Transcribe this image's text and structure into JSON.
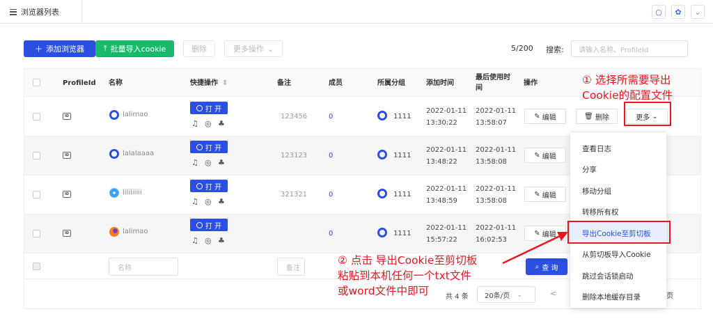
{
  "tab": {
    "title": "浏览器列表"
  },
  "top_icons": [
    "refresh-icon",
    "gear-icon",
    "chevron-down-icon"
  ],
  "toolbar": {
    "add_label": "添加浏览器",
    "import_label": "批量导入cookie",
    "delete_label": "删除",
    "more_ops_label": "更多操作",
    "count": "5/200",
    "search_label": "搜索:",
    "search_placeholder": "请输入名称、ProfileId"
  },
  "columns": {
    "profile_id": "ProfileId",
    "name": "名称",
    "quick_ops": "快捷操作",
    "note": "备注",
    "members": "成员",
    "group": "所属分组",
    "added": "添加时间",
    "last_used_1": "最后使用时",
    "last_used_2": "间",
    "ops": "操作"
  },
  "rows": [
    {
      "name": "lalimao",
      "browser": "chrome",
      "note": "123456",
      "members": "0",
      "group": "1111",
      "added_date": "2022-01-11",
      "added_time": "13:30:22",
      "used_date": "2022-01-11",
      "used_time": "13:58:07"
    },
    {
      "name": "lalalaaaa",
      "browser": "chrome",
      "note": "123123",
      "members": "0",
      "group": "1111",
      "added_date": "2022-01-11",
      "added_time": "13:48:22",
      "used_date": "2022-01-11",
      "used_time": "13:58:08"
    },
    {
      "name": "lililiiiii",
      "browser": "safari",
      "note": "321321",
      "members": "0",
      "group": "1111",
      "added_date": "2022-01-11",
      "added_time": "13:48:59",
      "used_date": "2022-01-11",
      "used_time": "13:58:08"
    },
    {
      "name": "lalimao",
      "browser": "firefox",
      "note": "",
      "members": "0",
      "group": "1111",
      "added_date": "2022-01-11",
      "added_time": "15:57:22",
      "used_date": "2022-01-11",
      "used_time": "16:02:53"
    }
  ],
  "row_actions": {
    "open": "打 开",
    "edit": "编辑",
    "delete": "删除",
    "more": "更多"
  },
  "filter": {
    "name_placeholder": "名称",
    "note_placeholder": "备注",
    "query": "查 询"
  },
  "pager": {
    "total": "共 4 条",
    "page_size": "20条/页",
    "prev": "<",
    "suffix": "页"
  },
  "menu": {
    "items": [
      "查看日志",
      "分享",
      "移动分组",
      "转移所有权",
      "导出Cookie至剪切板",
      "从剪切板导入Cookie",
      "跳过会话锁启动",
      "删除本地缓存目录"
    ],
    "active_index": 4
  },
  "annotations": {
    "step1_line1": "① 选择所需要导出",
    "step1_line2": "Cookie的配置文件",
    "step2_line1": "② 点击 导出Cookie至剪切板",
    "step2_line2": "粘贴到本机任何一个txt文件",
    "step2_line3": "或word文件中即可"
  },
  "colors": {
    "primary": "#2b4fe0",
    "green": "#19b96a",
    "annotation": "#e8161e"
  }
}
